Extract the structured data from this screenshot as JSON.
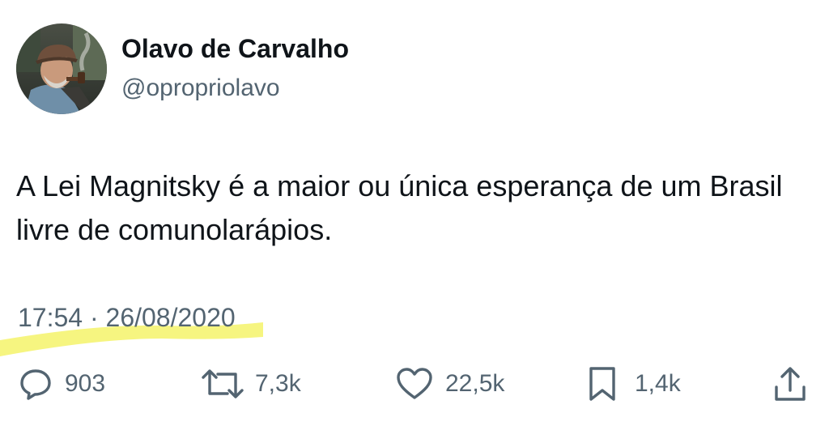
{
  "author": {
    "display_name": "Olavo de Carvalho",
    "handle": "@opropriolavo",
    "avatar_icon": "profile-photo"
  },
  "tweet": {
    "text": "A Lei Magnitsky é a maior ou única esperança de um Brasil livre de comunolarápios.",
    "timestamp": "17:54 · 26/08/2020"
  },
  "actions": {
    "replies": {
      "icon": "reply-icon",
      "count": "903"
    },
    "retweets": {
      "icon": "retweet-icon",
      "count": "7,3k"
    },
    "likes": {
      "icon": "heart-icon",
      "count": "22,5k"
    },
    "bookmarks": {
      "icon": "bookmark-icon",
      "count": "1,4k"
    },
    "share": {
      "icon": "share-icon"
    }
  },
  "colors": {
    "text_primary": "#0f1419",
    "text_secondary": "#536471",
    "highlight": "#f5f36a"
  }
}
